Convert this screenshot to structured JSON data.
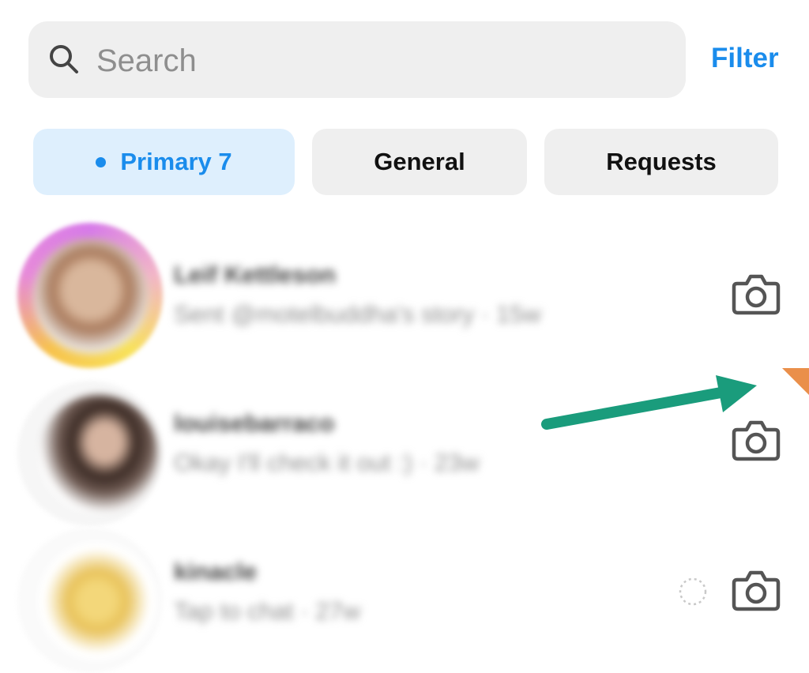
{
  "search": {
    "placeholder": "Search",
    "value": ""
  },
  "filter_label": "Filter",
  "tabs": [
    {
      "label": "Primary 7",
      "active": true,
      "unread_dot": true
    },
    {
      "label": "General",
      "active": false
    },
    {
      "label": "Requests",
      "active": false
    }
  ],
  "colors": {
    "accent": "#1a8cec",
    "active_tab_bg": "#deeffd",
    "tab_bg": "#efefef",
    "annotation_arrow": "#1a9c7c",
    "annotation_corner": "#ea8f4a"
  },
  "conversations": [
    {
      "name": "Leif Kettleson",
      "preview": "Sent @motelbuddha's story · 15w",
      "action_icon": "camera-icon",
      "avatar_ring": "story-gradient"
    },
    {
      "name": "louisebarraco",
      "preview": "Okay I'll check it out :) · 23w",
      "action_icon": "camera-icon"
    },
    {
      "name": "kinacle",
      "preview": "Tap to chat · 27w",
      "action_icon": "camera-icon",
      "status_icon": "loading-icon"
    }
  ],
  "annotation": {
    "type": "arrow",
    "points_to": "camera-icon"
  }
}
